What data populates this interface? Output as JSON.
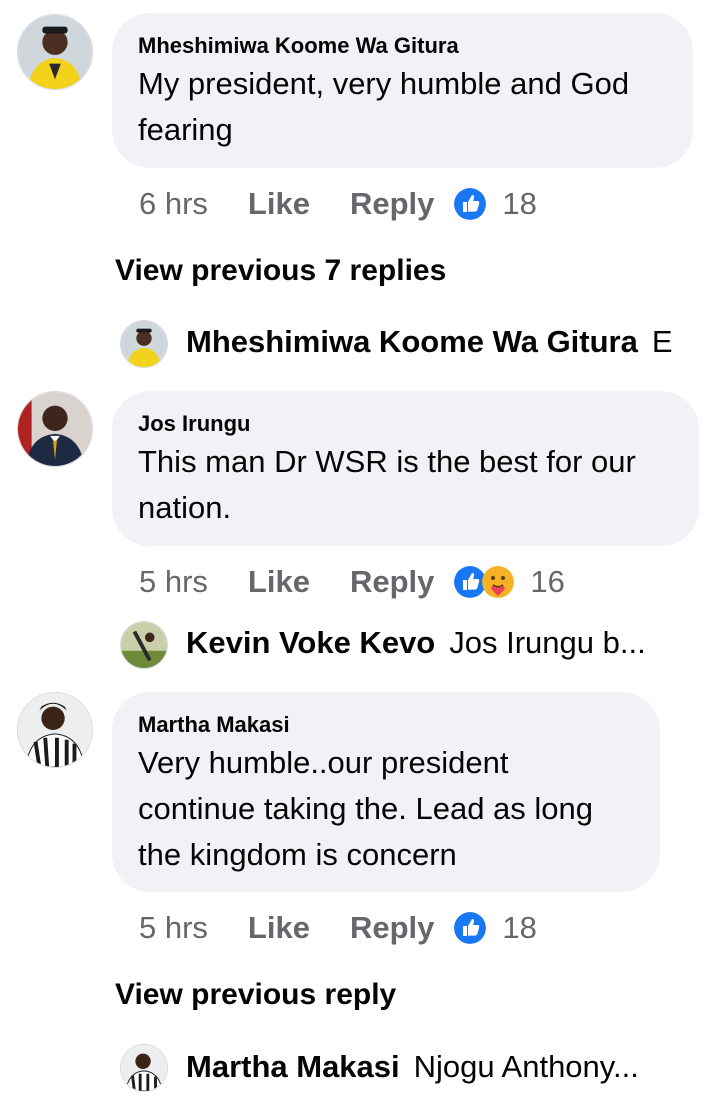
{
  "comments": [
    {
      "author": "Mheshimiwa Koome Wa Gitura",
      "text_lines": [
        "My president, very humble and God",
        "fearing"
      ],
      "time": "6 hrs",
      "like_label": "Like",
      "reply_label": "Reply",
      "reaction_count": "18",
      "reactions": [
        "like-icon"
      ]
    },
    {
      "author": "Jos Irungu",
      "text_lines": [
        "This man Dr WSR is the best for our",
        "nation."
      ],
      "time": "5 hrs",
      "like_label": "Like",
      "reply_label": "Reply",
      "reaction_count": "16",
      "reactions": [
        "like-icon",
        "care-icon"
      ]
    },
    {
      "author": "Martha Makasi",
      "text_lines": [
        "Very humble..our president",
        "continue taking the. Lead as long",
        "the kingdom is concern"
      ],
      "time": "5 hrs",
      "like_label": "Like",
      "reply_label": "Reply",
      "reaction_count": "18",
      "reactions": [
        "like-icon"
      ]
    }
  ],
  "view_previous": [
    "View previous 7 replies",
    "View previous reply"
  ],
  "reply_previews": [
    {
      "name": "Mheshimiwa Koome Wa Gitura",
      "text": "E"
    },
    {
      "name": "Kevin Voke Kevo",
      "text": "Jos Irungu b..."
    },
    {
      "name": "Martha Makasi",
      "text": "Njogu Anthony..."
    }
  ],
  "colors": {
    "bubble": "#f0f2f5",
    "secondary_text": "#65676b",
    "like_blue": "#1877f2"
  }
}
